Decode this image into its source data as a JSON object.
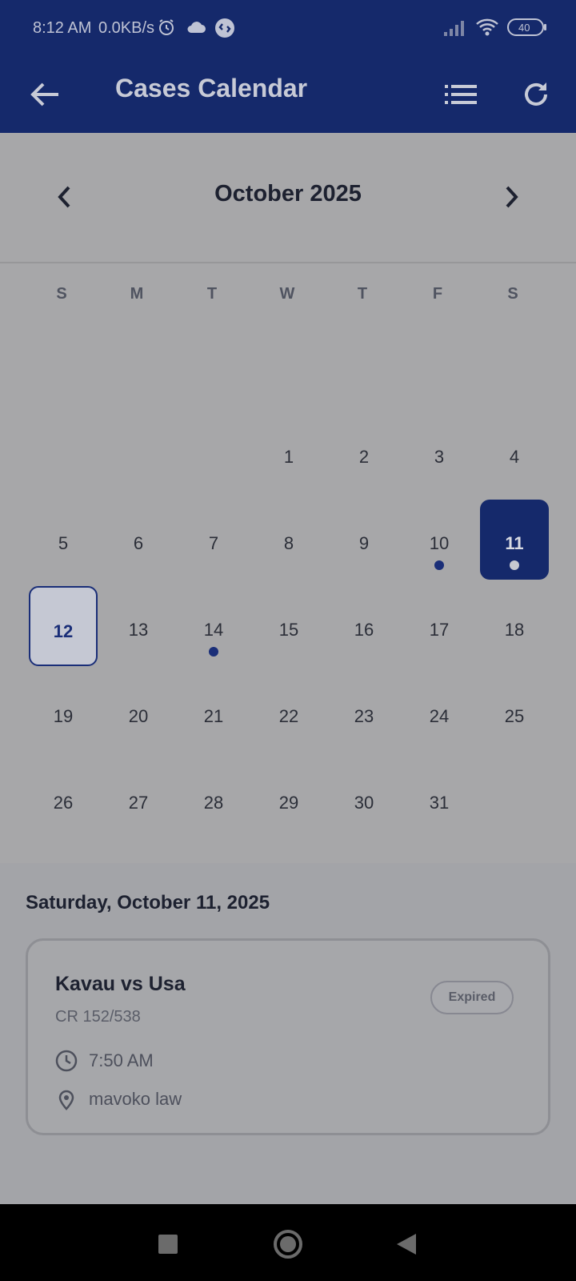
{
  "status_bar": {
    "time": "8:12 AM",
    "network_speed": "0.0KB/s",
    "battery": "40",
    "icons": [
      "alarm-icon",
      "cloud-icon",
      "shazam-icon",
      "signal-icon",
      "wifi-icon",
      "battery-icon"
    ]
  },
  "app_bar": {
    "title": "Cases Calendar",
    "icons": [
      "back-arrow-icon",
      "list-icon",
      "refresh-icon"
    ]
  },
  "calendar": {
    "month_label": "October 2025",
    "weekdays": [
      "S",
      "M",
      "T",
      "W",
      "T",
      "F",
      "S"
    ],
    "weeks": [
      [
        "",
        "",
        "",
        "1",
        "2",
        "3",
        "4"
      ],
      [
        "5",
        "6",
        "7",
        "8",
        "9",
        "10",
        "11"
      ],
      [
        "12",
        "13",
        "14",
        "15",
        "16",
        "17",
        "18"
      ],
      [
        "19",
        "20",
        "21",
        "22",
        "23",
        "24",
        "25"
      ],
      [
        "26",
        "27",
        "28",
        "29",
        "30",
        "31",
        ""
      ]
    ],
    "selected_day": "11",
    "today_day": "12",
    "days_with_cases": [
      "10",
      "11",
      "14"
    ]
  },
  "details": {
    "date_heading": "Saturday, October 11, 2025",
    "cases": [
      {
        "title": "Kavau vs Usa",
        "case_number": "CR 152/538",
        "status": "Expired",
        "time": "7:50 AM",
        "location": "mavoko law"
      }
    ]
  },
  "colors": {
    "primary": "#15296b",
    "dot": "#1a2e78",
    "background": "#a7a7a9"
  }
}
